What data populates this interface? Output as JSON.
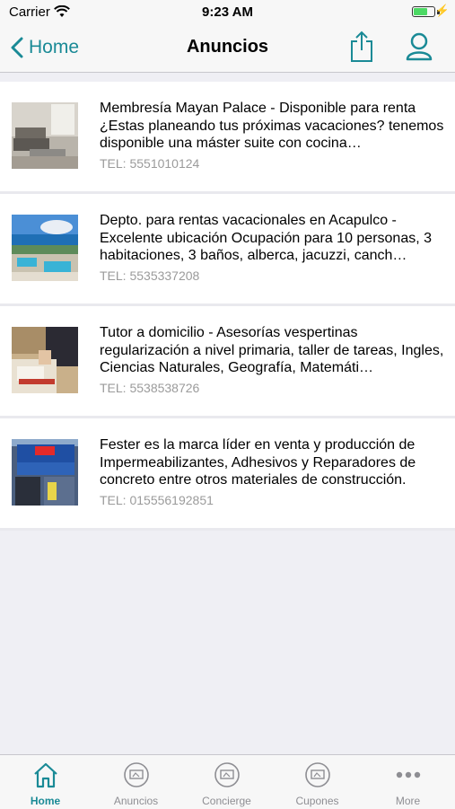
{
  "status_bar": {
    "carrier": "Carrier",
    "time": "9:23 AM",
    "battery_level": 0.7
  },
  "nav": {
    "back_label": "Home",
    "title": "Anuncios",
    "accent_color": "#1a8a96"
  },
  "ads": [
    {
      "title": "Membresía Mayan Palace - Disponible para renta ¿Estas planeando tus próximas vacaciones? tenemos disponible una máster suite con cocina…",
      "tel": "TEL: 5551010124",
      "image": "living-room-photo"
    },
    {
      "title": "Depto. para rentas vacacionales en Acapulco - Excelente ubicación Ocupación para 10 personas, 3 habitaciones, 3 baños, alberca, jacuzzi, canch…",
      "tel": "TEL: 5535337208",
      "image": "beach-resort-photo"
    },
    {
      "title": "Tutor a domicilio - Asesorías vespertinas regularización a nivel primaria, taller de tareas, Ingles, Ciencias Naturales, Geografía, Matemáti…",
      "tel": "TEL: 5538538726",
      "image": "tutoring-photo"
    },
    {
      "title": "Fester es la marca líder en venta y producción de Impermeabilizantes, Adhesivos y Reparadores de concreto entre otros materiales de construcción.",
      "tel": "TEL: 015556192851",
      "image": "storefront-photo"
    }
  ],
  "tabs": [
    {
      "label": "Home",
      "icon": "home-icon",
      "active": true
    },
    {
      "label": "Anuncios",
      "icon": "ads-icon",
      "active": false
    },
    {
      "label": "Concierge",
      "icon": "concierge-icon",
      "active": false
    },
    {
      "label": "Cupones",
      "icon": "coupons-icon",
      "active": false
    },
    {
      "label": "More",
      "icon": "more-icon",
      "active": false
    }
  ]
}
